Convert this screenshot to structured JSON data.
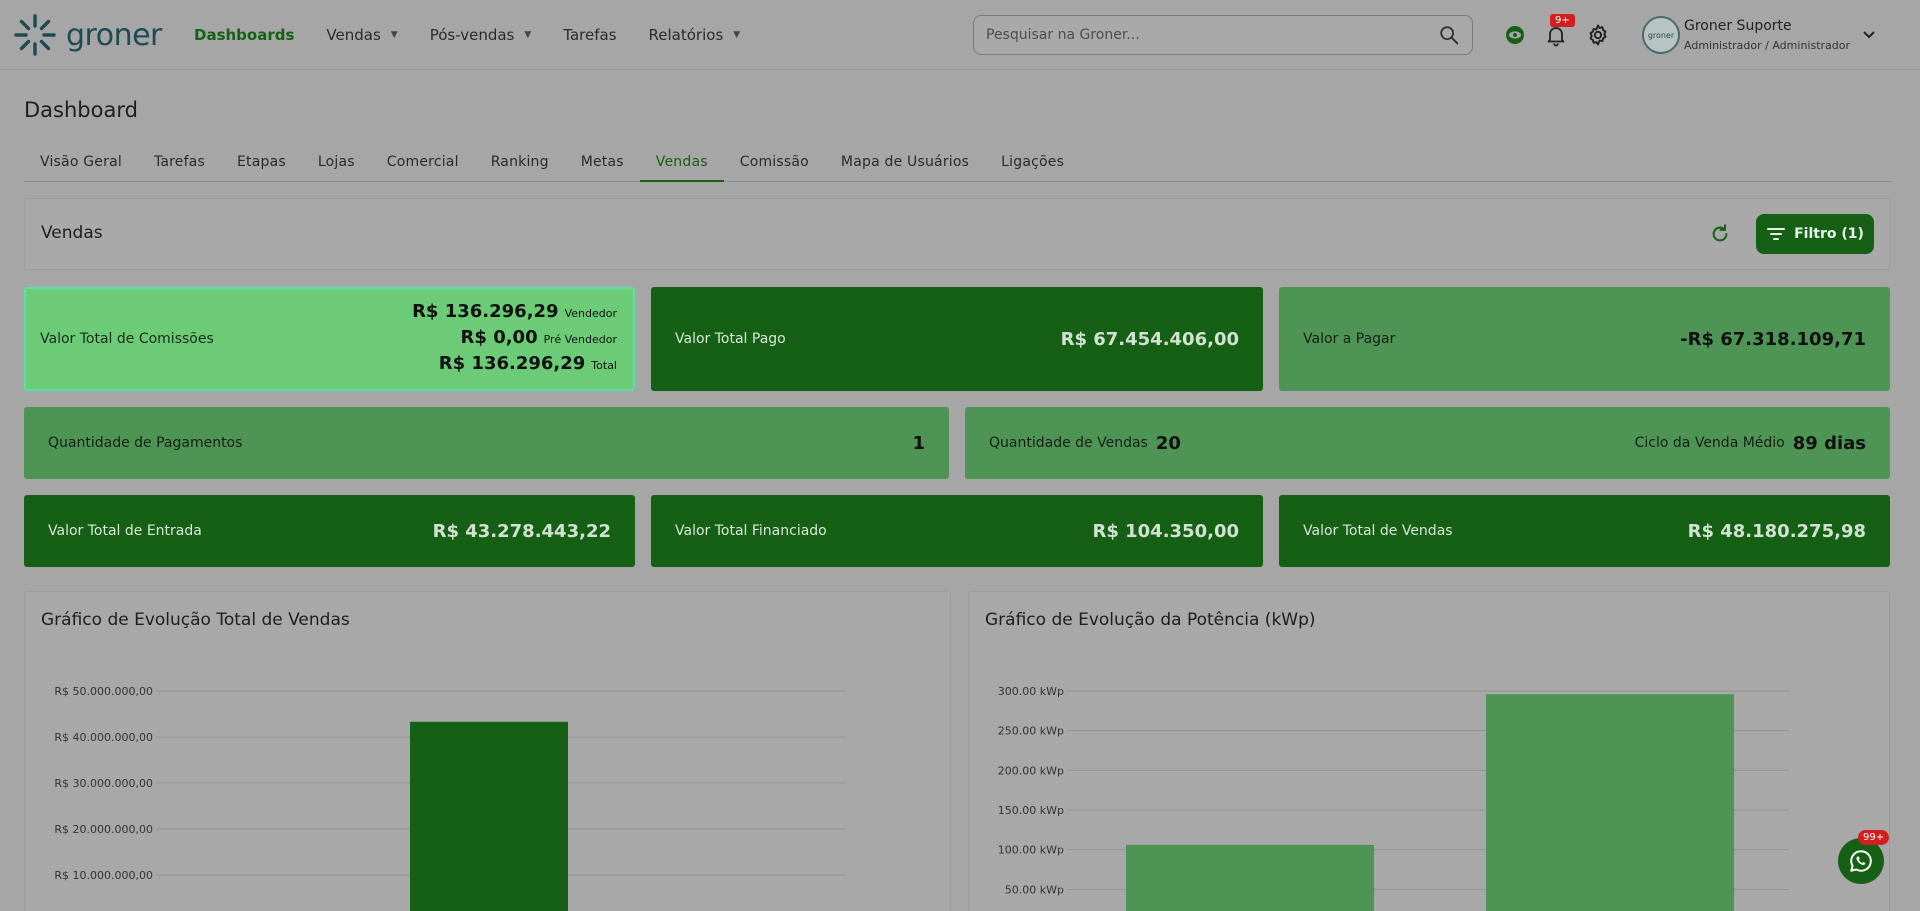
{
  "brand": {
    "name": "groner"
  },
  "nav": [
    {
      "label": "Dashboards",
      "active": true,
      "caret": false
    },
    {
      "label": "Vendas",
      "active": false,
      "caret": true
    },
    {
      "label": "Pós-vendas",
      "active": false,
      "caret": true
    },
    {
      "label": "Tarefas",
      "active": false,
      "caret": false
    },
    {
      "label": "Relatórios",
      "active": false,
      "caret": true
    }
  ],
  "search": {
    "placeholder": "Pesquisar na Groner..."
  },
  "notifications": {
    "badge": "9+"
  },
  "user": {
    "name": "Groner Suporte",
    "role": "Administrador / Administrador",
    "avatar_text": "groner"
  },
  "page": {
    "title": "Dashboard"
  },
  "tabs": [
    {
      "label": "Visão Geral",
      "active": false
    },
    {
      "label": "Tarefas",
      "active": false
    },
    {
      "label": "Etapas",
      "active": false
    },
    {
      "label": "Lojas",
      "active": false
    },
    {
      "label": "Comercial",
      "active": false
    },
    {
      "label": "Ranking",
      "active": false
    },
    {
      "label": "Metas",
      "active": false
    },
    {
      "label": "Vendas",
      "active": true
    },
    {
      "label": "Comissão",
      "active": false
    },
    {
      "label": "Mapa de Usuários",
      "active": false
    },
    {
      "label": "Ligações",
      "active": false
    }
  ],
  "section": {
    "title": "Vendas",
    "filter_label": "Filtro (1)"
  },
  "cards": {
    "comissoes": {
      "label": "Valor Total de Comissões",
      "rows": [
        {
          "amount": "R$ 136.296,29",
          "suffix": "Vendedor"
        },
        {
          "amount": "R$ 0,00",
          "suffix": "Pré Vendedor"
        },
        {
          "amount": "R$ 136.296,29",
          "suffix": "Total"
        }
      ]
    },
    "total_pago": {
      "label": "Valor Total Pago",
      "value": "R$ 67.454.406,00"
    },
    "a_pagar": {
      "label": "Valor a Pagar",
      "value": "-R$ 67.318.109,71"
    },
    "qtd_pagamentos": {
      "label": "Quantidade de Pagamentos",
      "value": "1"
    },
    "qtd_vendas": {
      "label": "Quantidade de Vendas",
      "value": "20",
      "ciclo_label": "Ciclo da Venda Médio",
      "ciclo_value": "89 dias"
    },
    "entrada": {
      "label": "Valor Total de Entrada",
      "value": "R$ 43.278.443,22"
    },
    "financiado": {
      "label": "Valor Total Financiado",
      "value": "R$ 104.350,00"
    },
    "vendas": {
      "label": "Valor Total de Vendas",
      "value": "R$ 48.180.275,98"
    }
  },
  "chat": {
    "badge": "99+"
  },
  "colors": {
    "primary": "#166016",
    "mid": "#4e9455",
    "light": "#6ccb76",
    "highlight": "#58e0a5",
    "badge": "#d11f1f"
  },
  "chart_data": [
    {
      "type": "bar",
      "title": "Gráfico de Evolução Total de Vendas",
      "yticks": [
        "R$ 10.000.000,00",
        "R$ 20.000.000,00",
        "R$ 30.000.000,00",
        "R$ 40.000.000,00",
        "R$ 50.000.000,00"
      ],
      "ylim": [
        0,
        50000000
      ],
      "values": [
        43300000
      ],
      "color": "#166016"
    },
    {
      "type": "bar",
      "title": "Gráfico de Evolução da Potência (kWp)",
      "yticks": [
        "50.00 kWp",
        "100.00 kWp",
        "150.00 kWp",
        "200.00 kWp",
        "250.00 kWp",
        "300.00 kWp"
      ],
      "ylim": [
        0,
        300
      ],
      "values": [
        106,
        296
      ],
      "color": "#4e9455"
    }
  ]
}
